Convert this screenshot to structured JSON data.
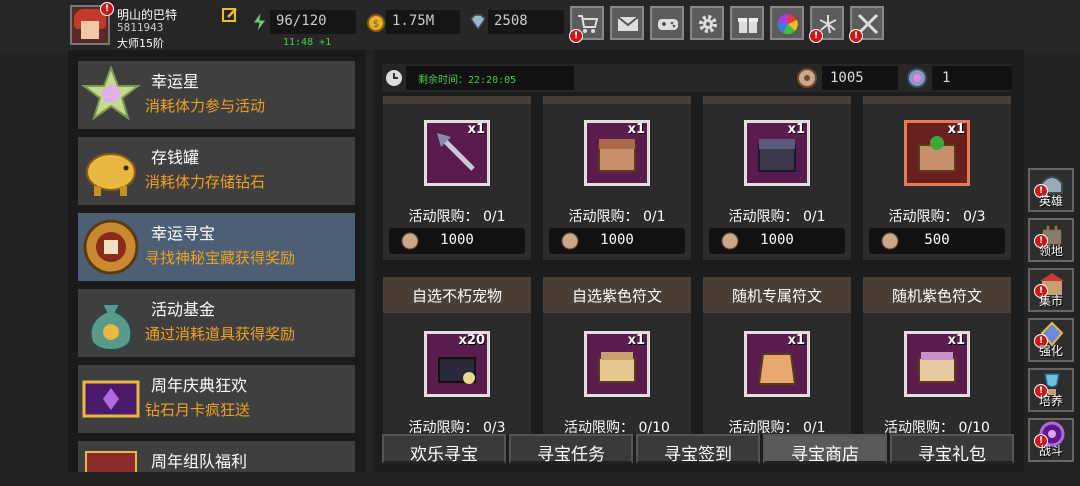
{
  "player": {
    "name": "明山的巴特",
    "id": "5811943",
    "rank": "大师15阶",
    "avatar_alert": "!"
  },
  "resources": {
    "stamina": "96/120",
    "stamina_timer": "11:48 +1",
    "gold": "1.75M",
    "gems": "2508"
  },
  "top_buttons": [
    {
      "name": "shop-cart",
      "alert": "!"
    },
    {
      "name": "mail",
      "alert": ""
    },
    {
      "name": "gamepad",
      "alert": ""
    },
    {
      "name": "settings",
      "alert": ""
    },
    {
      "name": "gift",
      "alert": ""
    },
    {
      "name": "color-wheel",
      "alert": ""
    },
    {
      "name": "fireworks",
      "alert": "!"
    },
    {
      "name": "crossed-swords",
      "alert": "!"
    }
  ],
  "events": [
    {
      "title": "幸运星",
      "desc": "消耗体力参与活动"
    },
    {
      "title": "存钱罐",
      "desc": "消耗体力存储钻石"
    },
    {
      "title": "幸运寻宝",
      "desc": "寻找神秘宝藏获得奖励"
    },
    {
      "title": "活动基金",
      "desc": "通过消耗道具获得奖励"
    },
    {
      "title": "周年庆典狂欢",
      "desc": "钻石月卡疯狂送"
    },
    {
      "title": "周年组队福利",
      "desc": ""
    }
  ],
  "shop": {
    "timer_label": "剩余时间：22:20:05",
    "coins": "1005",
    "tickets": "1",
    "row1": [
      {
        "title": "",
        "qty": "x1",
        "limit": "活动限购： 0/1",
        "price": "1000"
      },
      {
        "title": "",
        "qty": "x1",
        "limit": "活动限购： 0/1",
        "price": "1000"
      },
      {
        "title": "",
        "qty": "x1",
        "limit": "活动限购： 0/1",
        "price": "1000"
      },
      {
        "title": "",
        "qty": "x1",
        "limit": "活动限购： 0/3",
        "price": "500"
      }
    ],
    "row2": [
      {
        "title": "自选不朽宠物",
        "qty": "x20",
        "limit": "活动限购： 0/3"
      },
      {
        "title": "自选紫色符文",
        "qty": "x1",
        "limit": "活动限购： 0/10"
      },
      {
        "title": "随机专属符文",
        "qty": "x1",
        "limit": "活动限购： 0/1"
      },
      {
        "title": "随机紫色符文",
        "qty": "x1",
        "limit": "活动限购： 0/10"
      }
    ]
  },
  "bottom_tabs": [
    "欢乐寻宝",
    "寻宝任务",
    "寻宝签到",
    "寻宝商店",
    "寻宝礼包"
  ],
  "side_menu": [
    {
      "label": "英雄",
      "alert": "!"
    },
    {
      "label": "领地",
      "alert": "!"
    },
    {
      "label": "集市",
      "alert": "!"
    },
    {
      "label": "强化",
      "alert": "!"
    },
    {
      "label": "培养",
      "alert": "!"
    },
    {
      "label": "战斗",
      "alert": "!"
    }
  ]
}
